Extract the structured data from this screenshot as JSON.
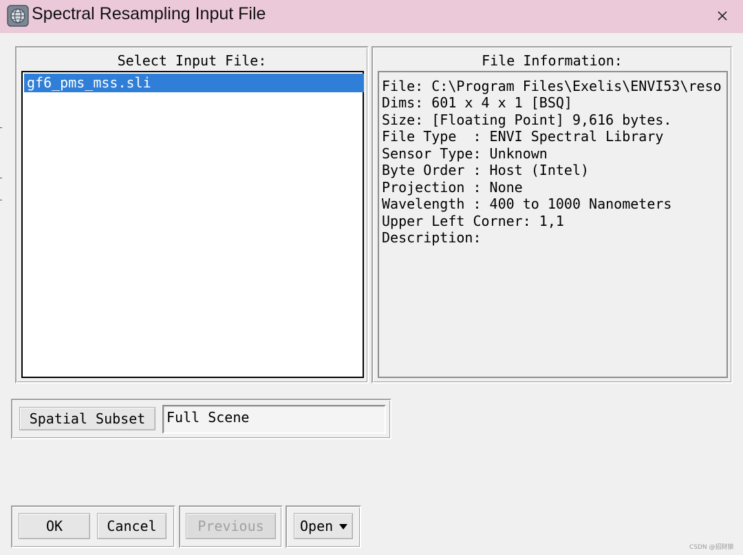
{
  "window": {
    "title": "Spectral Resampling Input File",
    "icon": "envi-globe-icon",
    "close_icon": "close-icon"
  },
  "select_input": {
    "label": "Select Input File:",
    "files": [
      "gf6_pms_mss.sli"
    ],
    "selected_index": 0
  },
  "file_information": {
    "label": "File Information:",
    "lines": [
      "File: C:\\Program Files\\Exelis\\ENVI53\\reso",
      "Dims: 601 x 4 x 1 [BSQ]",
      "Size: [Floating Point] 9,616 bytes.",
      "File Type  : ENVI Spectral Library",
      "Sensor Type: Unknown",
      "Byte Order : Host (Intel)",
      "Projection : None",
      "Wavelength : 400 to 1000 Nanometers",
      "Upper Left Corner: 1,1",
      "Description:"
    ]
  },
  "spatial_subset": {
    "button_label": "Spatial Subset",
    "value": "Full Scene"
  },
  "buttons": {
    "ok": "OK",
    "cancel": "Cancel",
    "previous": "Previous",
    "previous_enabled": false,
    "open": "Open"
  },
  "watermark": "CSDN @招财狼",
  "colors": {
    "titlebar": "#ebc9d9",
    "selection": "#2f7fd9",
    "background": "#f0f0f0"
  }
}
